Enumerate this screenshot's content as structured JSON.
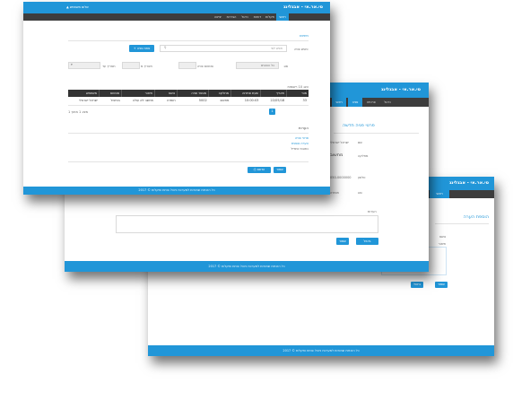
{
  "app": {
    "title": "סי.אר.אי - אבגלינג",
    "footer": "כל הזכויות שמורות למערכת ניהול פניות ותקלות © 2017"
  },
  "win1": {
    "user_label": "שלום משתמש",
    "nav": [
      "ראשי",
      "תקלות",
      "דוחות",
      "ניהול",
      "הגדרות",
      "יציאה"
    ],
    "section_title": "חיפוש",
    "search_label": "חפש פניה:",
    "search_placeholder": "חפש לפי",
    "new_button": "+ פתח פניה חדשה",
    "filters": [
      "סוג",
      "סטטוס פניה",
      "תאריך מ",
      "תאריך עד"
    ],
    "filter_value": "כל הסוגים",
    "pager_label": "הצג 10 רשומות",
    "table_headers": [
      "מס׳",
      "תאריך",
      "שעת פתיחה",
      "מחלקה",
      "מספר פניה",
      "נושא",
      "תיאור",
      "סטטוס",
      "משתמש"
    ],
    "row": [
      "33",
      "22/05/18",
      "10:00:03",
      "מחשוב",
      "5002",
      "חומרה",
      "מחשב לא עולה",
      "בטיפול",
      "ישראל ישראלי"
    ],
    "row_count_label": "מציג 1 מתוך 1",
    "notes_title": "הערות",
    "notes_lines": [
      "פרטי פניה",
      "הערה נוספת",
      "כתובת אימייל"
    ],
    "save_button": "שמור",
    "print_button": "הדפס"
  },
  "win2": {
    "nav": [
      "ראשי",
      "פניה",
      "פרטים",
      "ניהול"
    ],
    "form_title": "פרטי פניה חדשה",
    "labels": [
      "שם",
      "מחלקה",
      "טלפון",
      "סוג",
      "תיאור"
    ],
    "values": [
      "ישראל ישראלי",
      "מחשוב",
      "050-0000000",
      "חומרה"
    ],
    "notes_label": "הערות",
    "save_button": "שמור",
    "cancel_button": "ביטול"
  },
  "win3": {
    "nav": [
      "ראשי"
    ],
    "form_title": "הוספת הערה",
    "labels": [
      "נושא",
      "תיאור"
    ],
    "save_button": "שמור",
    "cancel_button": "ביטול"
  },
  "colors": {
    "primary": "#2196d8",
    "nav": "#3d3d3d"
  }
}
